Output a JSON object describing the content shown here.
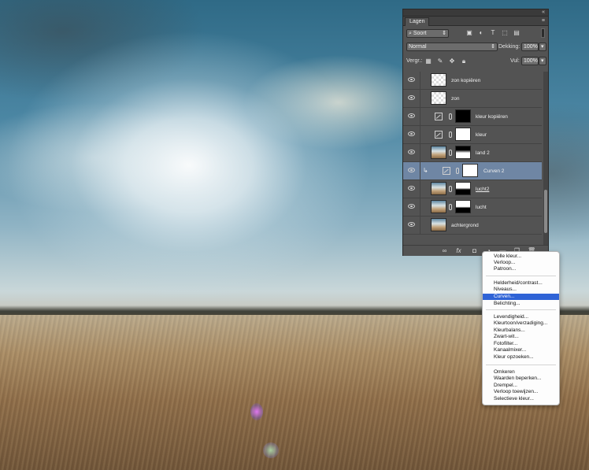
{
  "background": {
    "description_colors": {
      "sky": "#4b86a3",
      "field": "#a88b64"
    }
  },
  "panel": {
    "collapse_glyph": "«",
    "tab_label": "Lagen",
    "filter": {
      "label": "Soort"
    },
    "blend_mode": "Normal",
    "opacity_label": "Dekking:",
    "opacity_value": "100%",
    "lock_label": "Vergr.:",
    "fill_label": "Vul:",
    "fill_value": "100%",
    "layers": [
      {
        "name": "zon kopiëren",
        "kind": "empty",
        "selected": false
      },
      {
        "name": "zon",
        "kind": "empty",
        "selected": false
      },
      {
        "name": "kleur kopiëren",
        "kind": "adjustment",
        "selected": false
      },
      {
        "name": "kleur",
        "kind": "adjustment",
        "selected": false
      },
      {
        "name": "land 2",
        "kind": "photo",
        "selected": false
      },
      {
        "name": "Curven 2",
        "kind": "adjustment",
        "selected": true
      },
      {
        "name": "lucht2",
        "kind": "photo",
        "selected": false
      },
      {
        "name": "lucht",
        "kind": "photo",
        "selected": false
      },
      {
        "name": "achtergrond",
        "kind": "photo",
        "selected": false
      }
    ],
    "bottom_icons": [
      "link-icon",
      "fx-icon",
      "mask-icon",
      "adjustment-icon",
      "folder-icon",
      "new-layer-icon",
      "trash-icon"
    ]
  },
  "menu": {
    "groups": [
      [
        "Volle kleur...",
        "Verloop...",
        "Patroon..."
      ],
      [
        "Helderheid/contrast...",
        "Niveaus...",
        "Curven...",
        "Belichting..."
      ],
      [
        "Levendigheid...",
        "Kleurtoon/verzadiging...",
        "Kleurbalans...",
        "Zwart-wit...",
        "Fotofilter...",
        "Kanaalmixer...",
        "Kleur opzoeken..."
      ],
      [
        "Omkeren",
        "Waarden beperken...",
        "Drempel...",
        "Verloop toewijzen...",
        "Selectieve kleur..."
      ]
    ],
    "highlighted": "Curven..."
  }
}
